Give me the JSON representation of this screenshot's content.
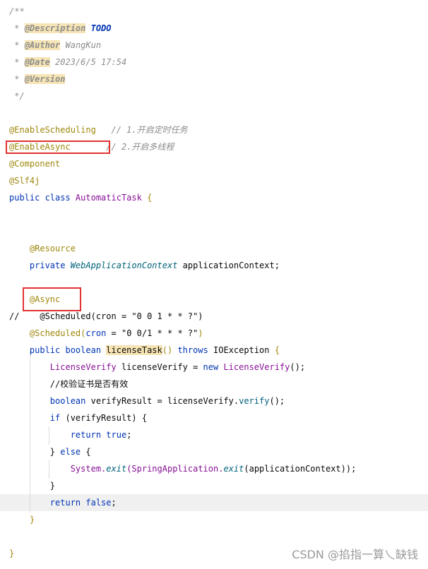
{
  "code": {
    "lines": [
      [
        {
          "t": "/**",
          "c": "t-comment"
        }
      ],
      [
        {
          "t": " * ",
          "c": "t-comment"
        },
        {
          "t": "@Description",
          "c": "t-tag"
        },
        {
          "t": " ",
          "c": "t-comment"
        },
        {
          "t": "TODO",
          "c": "t-todo"
        }
      ],
      [
        {
          "t": " * ",
          "c": "t-comment"
        },
        {
          "t": "@Author",
          "c": "t-tag"
        },
        {
          "t": " WangKun",
          "c": "t-doc"
        }
      ],
      [
        {
          "t": " * ",
          "c": "t-comment"
        },
        {
          "t": "@Date",
          "c": "t-tag"
        },
        {
          "t": " 2023/6/5 17:54",
          "c": "t-doc"
        }
      ],
      [
        {
          "t": " * ",
          "c": "t-comment"
        },
        {
          "t": "@Version",
          "c": "t-tag"
        }
      ],
      [
        {
          "t": " */",
          "c": "t-comment"
        }
      ],
      [],
      [
        {
          "t": "@EnableScheduling",
          "c": "t-annot"
        },
        {
          "t": "   // 1.开启定时任务",
          "c": "t-comment"
        }
      ],
      [
        {
          "t": "@EnableAsync",
          "c": "t-annot"
        },
        {
          "t": "       // 2.开启多线程",
          "c": "t-comment"
        }
      ],
      [
        {
          "t": "@Component",
          "c": "t-annot"
        }
      ],
      [
        {
          "t": "@Slf4j",
          "c": "t-annot"
        }
      ],
      [
        {
          "t": "public class ",
          "c": "t-keyword"
        },
        {
          "t": "AutomaticTask",
          "c": "t-field"
        },
        {
          "t": " {",
          "c": "t-annot"
        }
      ],
      [],
      [],
      [
        {
          "t": "    "
        },
        {
          "t": "@Resource",
          "c": "t-annot"
        }
      ],
      [
        {
          "t": "    "
        },
        {
          "t": "private ",
          "c": "t-keyword"
        },
        {
          "t": "WebApplicationContext",
          "c": "t-static"
        },
        {
          "t": " applicationContext;",
          "c": "t-plain"
        }
      ],
      [],
      [
        {
          "t": "    "
        },
        {
          "t": "@Async",
          "c": "t-annot"
        }
      ],
      [
        {
          "t": "//    @Scheduled(cron = \"0 0 1 * * ?\")",
          "c": "t-plain"
        }
      ],
      [
        {
          "t": "    "
        },
        {
          "t": "@Scheduled(",
          "c": "t-annot"
        },
        {
          "t": "cron",
          "c": "t-keyword"
        },
        {
          "t": " = ",
          "c": "t-plain"
        },
        {
          "t": "\"0 0/1 * * * ?\"",
          "c": "t-plain"
        },
        {
          "t": ")",
          "c": "t-annot"
        }
      ],
      [
        {
          "t": "    "
        },
        {
          "t": "public boolean ",
          "c": "t-keyword"
        },
        {
          "t": "licenseTask",
          "c": "t-highlight"
        },
        {
          "t": "() ",
          "c": "t-annot"
        },
        {
          "t": "throws ",
          "c": "t-keyword"
        },
        {
          "t": "IOException",
          "c": "t-plain"
        },
        {
          "t": " {",
          "c": "t-annot"
        }
      ],
      [
        {
          "t": "        "
        },
        {
          "t": "LicenseVerify",
          "c": "t-field"
        },
        {
          "t": " licenseVerify = ",
          "c": "t-plain"
        },
        {
          "t": "new ",
          "c": "t-keyword"
        },
        {
          "t": "LicenseVerify",
          "c": "t-field"
        },
        {
          "t": "();",
          "c": "t-plain"
        }
      ],
      [
        {
          "t": "        "
        },
        {
          "t": "//校验证书是否有效",
          "c": "t-plain"
        }
      ],
      [
        {
          "t": "        "
        },
        {
          "t": "boolean ",
          "c": "t-keyword"
        },
        {
          "t": "verifyResult = licenseVerify.",
          "c": "t-plain"
        },
        {
          "t": "verify",
          "c": "t-method-call"
        },
        {
          "t": "();",
          "c": "t-plain"
        }
      ],
      [
        {
          "t": "        "
        },
        {
          "t": "if ",
          "c": "t-keyword"
        },
        {
          "t": "(verifyResult) {",
          "c": "t-plain"
        }
      ],
      [
        {
          "t": "            "
        },
        {
          "t": "return true",
          "c": "t-keyword"
        },
        {
          "t": ";",
          "c": "t-plain"
        }
      ],
      [
        {
          "t": "        "
        },
        {
          "t": "} ",
          "c": "t-plain"
        },
        {
          "t": "else ",
          "c": "t-keyword"
        },
        {
          "t": "{",
          "c": "t-plain"
        }
      ],
      [
        {
          "t": "            "
        },
        {
          "t": "System.",
          "c": "t-field"
        },
        {
          "t": "exit",
          "c": "t-static"
        },
        {
          "t": "(SpringApplication.",
          "c": "t-field"
        },
        {
          "t": "exit",
          "c": "t-static"
        },
        {
          "t": "(applicationContext));",
          "c": "t-plain"
        }
      ],
      [
        {
          "t": "        "
        },
        {
          "t": "}",
          "c": "t-plain"
        }
      ],
      [
        {
          "t": "        "
        },
        {
          "t": "return false",
          "c": "t-keyword"
        },
        {
          "t": ";",
          "c": "t-plain"
        }
      ],
      [
        {
          "t": "    "
        },
        {
          "t": "}",
          "c": "t-annot"
        }
      ],
      [],
      [
        {
          "t": "}",
          "c": "t-annot"
        }
      ]
    ]
  },
  "watermark": "CSDN @掐指一算乀缺钱"
}
